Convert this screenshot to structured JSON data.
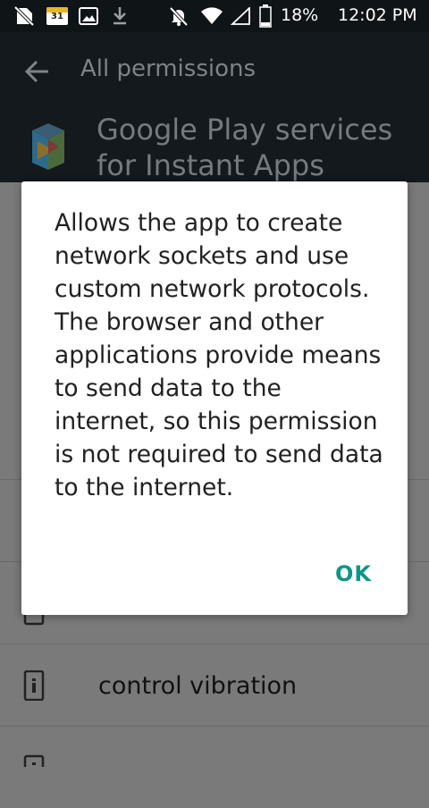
{
  "status_bar": {
    "calendar_day": "31",
    "battery": "18%",
    "time": "12:02 PM"
  },
  "app_bar": {
    "title": "All permissions"
  },
  "app_header": {
    "app_name": "Google Play services for Instant Apps"
  },
  "list": {
    "items": [
      {
        "label": "control vibration"
      }
    ]
  },
  "dialog": {
    "message": "Allows the app to create network sockets and use custom network protocols. The browser and other applications provide means to send data to the internet, so this permission is not required to send data to the internet.",
    "ok_label": "OK"
  },
  "colors": {
    "accent": "#0b9688",
    "app_bar_bg": "#13191c",
    "status_bar_bg": "#0f1416",
    "scrim": "#7a7a7a"
  },
  "icons": {
    "status_left": [
      "no-sim-icon",
      "calendar-icon",
      "image-icon",
      "download-icon"
    ],
    "status_right": [
      "mute-icon",
      "wifi-icon",
      "signal-icon",
      "battery-icon"
    ],
    "back": "arrow-back-icon",
    "app_logo": "play-instant-logo",
    "list_item": "phone-info-icon"
  }
}
